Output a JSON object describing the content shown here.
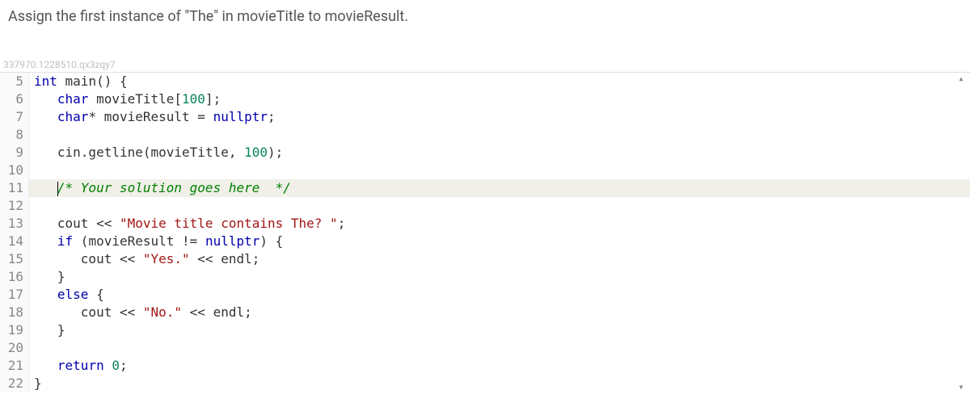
{
  "instruction": "Assign the first instance of \"The\" in movieTitle to movieResult.",
  "watermark": "337970.1228510.qx3zqy7",
  "gutter": [
    "5",
    "6",
    "7",
    "8",
    "9",
    "10",
    "11",
    "12",
    "13",
    "14",
    "15",
    "16",
    "17",
    "18",
    "19",
    "20",
    "21",
    "22"
  ],
  "code": {
    "l5": {
      "t1": "int",
      "t2": " main() {"
    },
    "l6": {
      "t1": "   ",
      "t2": "char",
      "t3": " movieTitle[",
      "t4": "100",
      "t5": "];"
    },
    "l7": {
      "t1": "   ",
      "t2": "char",
      "t3": "* movieResult = ",
      "t4": "nullptr",
      "t5": ";"
    },
    "l8": "",
    "l9": {
      "t1": "   cin.getline(movieTitle, ",
      "t2": "100",
      "t3": ");"
    },
    "l10": "",
    "l11": {
      "t1": "   ",
      "t2": "/* Your solution goes here  */"
    },
    "l12": "",
    "l13": {
      "t1": "   cout << ",
      "t2": "\"Movie title contains The? \"",
      "t3": ";"
    },
    "l14": {
      "t1": "   ",
      "t2": "if",
      "t3": " (movieResult != ",
      "t4": "nullptr",
      "t5": ") {"
    },
    "l15": {
      "t1": "      cout << ",
      "t2": "\"Yes.\"",
      "t3": " << endl;"
    },
    "l16": {
      "t1": "   }"
    },
    "l17": {
      "t1": "   ",
      "t2": "else",
      "t3": " {"
    },
    "l18": {
      "t1": "      cout << ",
      "t2": "\"No.\"",
      "t3": " << endl;"
    },
    "l19": {
      "t1": "   }"
    },
    "l20": "",
    "l21": {
      "t1": "   ",
      "t2": "return",
      "t3": " ",
      "t4": "0",
      "t5": ";"
    },
    "l22": {
      "t1": "}"
    }
  }
}
